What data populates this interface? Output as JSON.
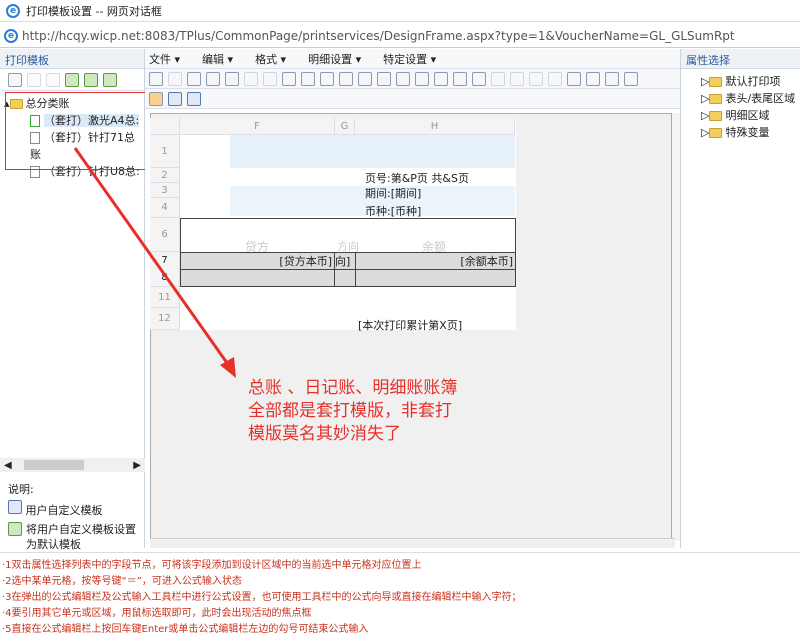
{
  "window": {
    "title": "打印模板设置 -- 网页对话框",
    "url": "http://hcqy.wicp.net:8083/TPlus/CommonPage/printservices/DesignFrame.aspx?type=1&VoucherName=GL_GLSumRpt"
  },
  "left": {
    "title": "打印模板",
    "tree": {
      "root": "总分类账",
      "items": [
        "（套打）激光A4总:",
        "（套打）针打71总账",
        "（套打）针打U8总:"
      ]
    },
    "legend_title": "说明:",
    "legend": [
      "用户自定义模板",
      "将用户自定义模板设置",
      "为默认模板"
    ]
  },
  "menu": [
    "文件 ▾",
    "编辑 ▾",
    "格式 ▾",
    "明细设置 ▾",
    "特定设置 ▾"
  ],
  "grid": {
    "columns": [
      "F",
      "G",
      "H"
    ],
    "rows": [
      "1",
      "2",
      "3",
      "4",
      "6",
      "7",
      "8",
      "11",
      "12"
    ],
    "cells": {
      "page": "页号:第&P页 共&S页",
      "period": "期间:[期间]",
      "currency": "币种:[币种]",
      "credit_hdr": "贷方",
      "dir_hdr": "方向",
      "balance_hdr": "余额",
      "credit": "[贷方本币]",
      "dir": "向]",
      "balance": "[余额本币]",
      "footer": "[本次打印累计第X页]"
    }
  },
  "right": {
    "title": "属性选择",
    "items": [
      "默认打印项",
      "表头/表尾区域",
      "明细区域",
      "特殊变量"
    ]
  },
  "annotation": [
    "总账 、日记账、明细账账簿",
    "全部都是套打模版，非套打",
    "模版莫名其妙消失了"
  ],
  "notes": [
    "·1双击属性选择列表中的字段节点，可将该字段添加到设计区域中的当前选中单元格对应位置上",
    "·2选中某单元格，按等号键“＝”，可进入公式输入状态",
    "·3在弹出的公式编辑栏及公式输入工具栏中进行公式设置，也可使用工具栏中的公式向导或直接在编辑栏中输入字符；",
    "·4要引用其它单元或区域，用鼠标选取即可，此时会出现活动的焦点框",
    "·5直接在公式编辑栏上按回车键Enter或单击公式编辑栏左边的勾号可结束公式输入"
  ],
  "colors": {
    "annotation": "#e8302a",
    "notes": "#c8321e",
    "panel_title": "#2a5a9a"
  }
}
